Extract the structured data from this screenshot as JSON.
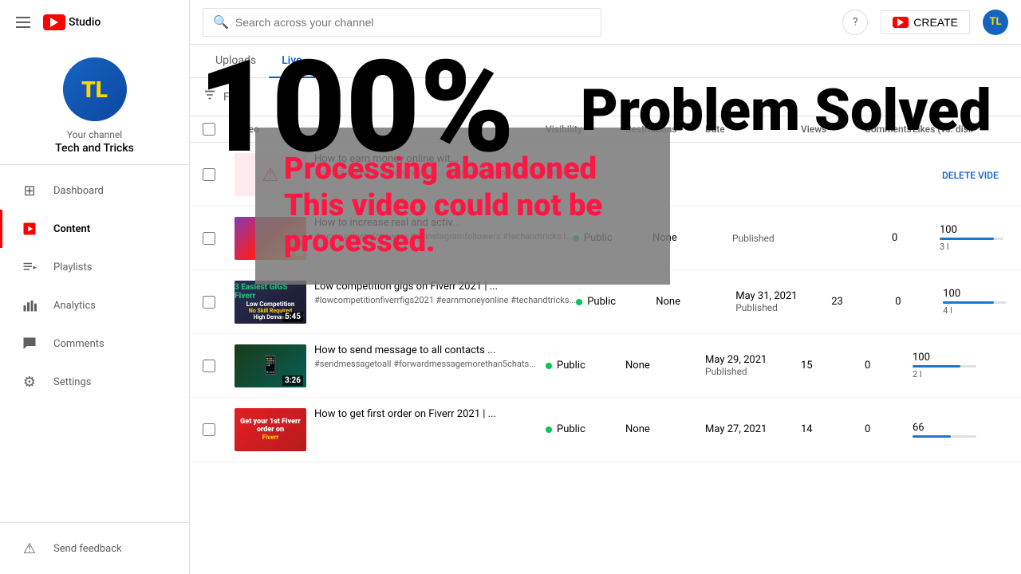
{
  "sidebar": {
    "logo_text": "Studio",
    "channel": {
      "avatar_text": "TL",
      "your_channel": "Your channel",
      "name": "Tech and Tricks"
    },
    "nav": [
      {
        "id": "dashboard",
        "label": "Dashboard",
        "icon": "⊞",
        "active": false
      },
      {
        "id": "content",
        "label": "Content",
        "icon": "▶",
        "active": true
      },
      {
        "id": "playlists",
        "label": "Playlists",
        "icon": "≡",
        "active": false
      },
      {
        "id": "analytics",
        "label": "Analytics",
        "icon": "📊",
        "active": false
      },
      {
        "id": "comments",
        "label": "Comments",
        "icon": "💬",
        "active": false
      },
      {
        "id": "settings",
        "label": "Settings",
        "icon": "⚙",
        "active": false
      }
    ],
    "send_feedback": "Send feedback"
  },
  "header": {
    "search_placeholder": "Search across your channel",
    "create_label": "CREATE"
  },
  "tabs": [
    {
      "id": "uploads",
      "label": "Uploads",
      "active": false
    },
    {
      "id": "live",
      "label": "Live",
      "active": false
    }
  ],
  "filter": {
    "label": "Filter"
  },
  "table": {
    "headers": [
      "",
      "Video",
      "Visibility",
      "Restrictions",
      "Date",
      "Views",
      "Comments",
      "Likes (vs. disli"
    ],
    "rows": [
      {
        "id": 1,
        "title": "How to earn money online wit...",
        "tags": "#earnmoneyonline #onlineearni... #earnonlinemoney In this video...",
        "thumb_type": "error",
        "visibility": "",
        "restrictions": "",
        "date": "",
        "date_sub": "",
        "views": "",
        "comments": "",
        "likes": "",
        "bar_pct": 0,
        "action": "DELETE VIDE"
      },
      {
        "id": 2,
        "title": "How to increase real and activ...",
        "tags": "#increaseinstafollowers #geinstagramfollowers #techandtricks I...",
        "thumb_color": "thumb-ig",
        "thumb_duration": "6:46",
        "visibility": "Public",
        "restrictions": "None",
        "date": "",
        "date_sub": "Published",
        "views": "",
        "comments": "0",
        "likes": "100",
        "bar_pct": 85,
        "bar_sub": "3 l"
      },
      {
        "id": 3,
        "title": "Low competition gigs on Fiverr 2021 | ...",
        "tags": "#lowcompetitionfiverrfigs2021 #earnmoneyonline #techandtricks...",
        "thumb_color": "thumb-fiverr",
        "thumb_duration": "5:45",
        "visibility": "Public",
        "restrictions": "None",
        "date": "May 31, 2021",
        "date_sub": "Published",
        "views": "23",
        "comments": "0",
        "likes": "100",
        "bar_pct": 80,
        "bar_sub": "4 l"
      },
      {
        "id": 4,
        "title": "How to send message to all contacts ...",
        "tags": "#sendmessagetoall #forwardmessagemorethan5chats...",
        "thumb_color": "thumb-msg",
        "thumb_duration": "3:26",
        "visibility": "Public",
        "restrictions": "None",
        "date": "May 29, 2021",
        "date_sub": "Published",
        "views": "15",
        "comments": "0",
        "likes": "100",
        "bar_pct": 75,
        "bar_sub": "2 l"
      },
      {
        "id": 5,
        "title": "How to get first order on Fiverr 2021 | ...",
        "tags": "",
        "thumb_color": "thumb-fiverr2",
        "thumb_duration": "",
        "visibility": "Public",
        "restrictions": "None",
        "date": "May 27, 2021",
        "date_sub": "",
        "views": "14",
        "comments": "0",
        "likes": "66",
        "bar_pct": 60,
        "bar_sub": ""
      }
    ]
  },
  "overlay": {
    "line1": "Processing abandoned",
    "line2": "This video  could not be",
    "line3": "processed."
  },
  "big_overlay": {
    "percent": "100%",
    "text": "Problem Solved"
  }
}
